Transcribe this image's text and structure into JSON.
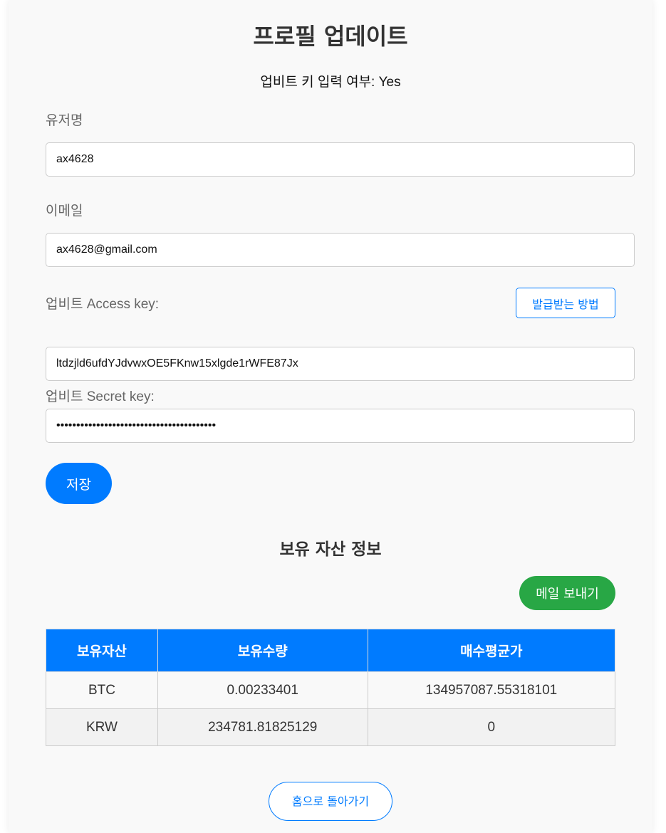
{
  "page": {
    "title": "프로필 업데이트",
    "key_status_label": "업비트 키 입력 여부: ",
    "key_status_value": "Yes"
  },
  "form": {
    "username_label": "유저명",
    "username_value": "ax4628",
    "email_label": "이메일",
    "email_value": "ax4628@gmail.com",
    "access_key_label": "업비트 Access key:",
    "access_key_value": "ltdzjld6ufdYJdvwxOE5FKnw15xlgde1rWFE87Jx",
    "guide_button_label": "발급받는 방법",
    "secret_key_label": "업비트 Secret key:",
    "secret_key_value": "••••••••••••••••••••••••••••••••••••••••",
    "save_button_label": "저장"
  },
  "assets": {
    "title": "보유 자산 정보",
    "mail_button_label": "메일 보내기",
    "columns": [
      "보유자산",
      "보유수량",
      "매수평균가"
    ],
    "rows": [
      [
        "BTC",
        "0.00233401",
        "134957087.55318101"
      ],
      [
        "KRW",
        "234781.81825129",
        "0"
      ]
    ]
  },
  "footer": {
    "home_link_label": "홈으로 돌아가기"
  },
  "colors": {
    "primary": "#007bff",
    "success": "#28a745",
    "card_background": "#f9f9f9"
  }
}
